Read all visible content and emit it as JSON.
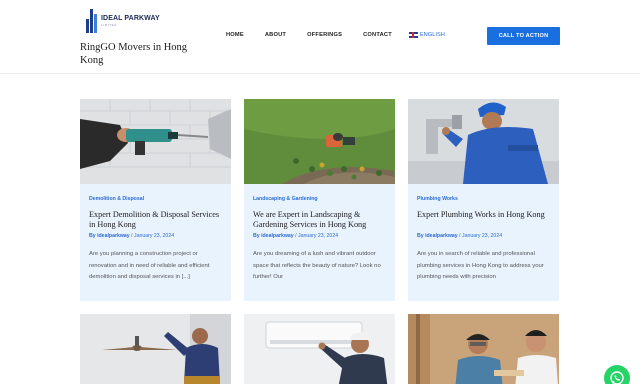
{
  "header": {
    "logo_name": "IDEAL PARKWAY",
    "logo_sub": "LIMITED",
    "site_title": "RingGO Movers in Hong Kong",
    "nav": [
      "HOME",
      "ABOUT",
      "OFFERINGS",
      "CONTACT"
    ],
    "language": "ENGLISH",
    "cta": "CALL TO ACTION"
  },
  "posts": [
    {
      "category": "Demolition & Disposal",
      "title": "Expert Demolition & Disposal Services in Hong Kong",
      "author": "By idealparkway",
      "date": "January 23, 2024",
      "excerpt": "Are you planning a construction project or renovation and in need of reliable and efficient demolition and disposal services in [...]"
    },
    {
      "category": "Landscaping & Gardening",
      "title": "We are Expert in Landscaping & Gardening Services in Hong Kong",
      "author": "By idealparkway",
      "date": "January 23, 2024",
      "excerpt": "Are you dreaming of a lush and vibrant outdoor space that reflects the beauty of nature? Look no further! Our"
    },
    {
      "category": "Plumbing Works",
      "title": "Expert Plumbing Works in Hong Kong",
      "author": "By idealparkway",
      "date": "January 23, 2024",
      "excerpt": "Are you in search of reliable and professional plumbing services in Hong Kong to address your plumbing needs with precision"
    }
  ],
  "icons": {
    "language_flag": "uk-flag-icon",
    "chat": "whatsapp-icon"
  },
  "colors": {
    "accent": "#1a6fe0",
    "card_bg": "#e9f3fd",
    "whatsapp": "#25d366"
  }
}
